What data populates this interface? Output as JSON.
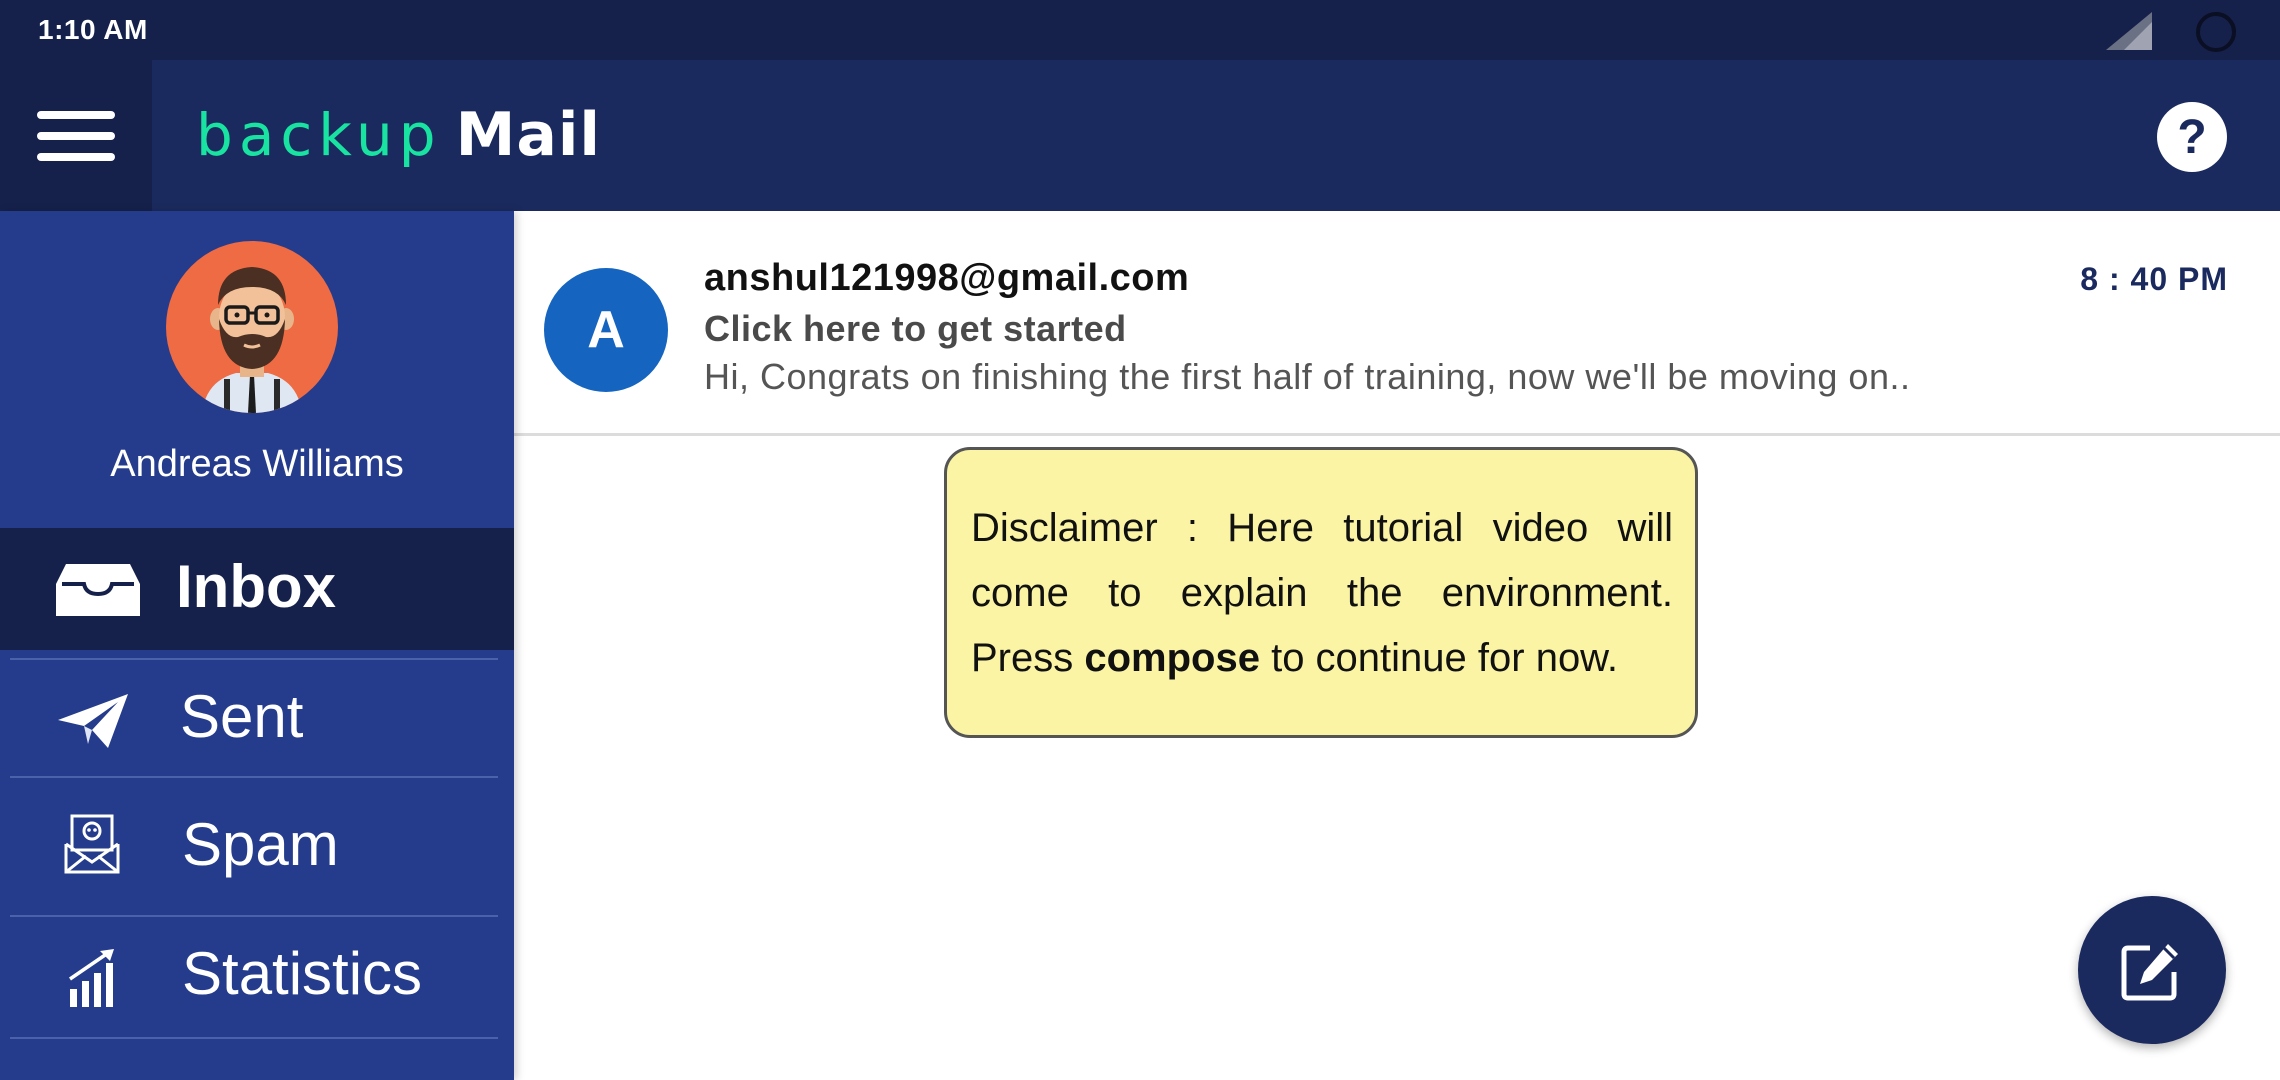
{
  "status_bar": {
    "time": "1:10 AM",
    "icons": [
      "signal-icon",
      "battery-loading-icon"
    ]
  },
  "app_bar": {
    "menu_icon": "hamburger-menu-icon",
    "logo_part1": "backup",
    "logo_part2": "Mail",
    "help_label": "?"
  },
  "sidebar": {
    "user_name": "Andreas Williams",
    "items": [
      {
        "label": "Inbox",
        "icon": "inbox-tray-icon",
        "active": true
      },
      {
        "label": "Sent",
        "icon": "paper-plane-icon",
        "active": false
      },
      {
        "label": "Spam",
        "icon": "spam-envelope-icon",
        "active": false
      },
      {
        "label": "Statistics",
        "icon": "bar-chart-icon",
        "active": false
      }
    ]
  },
  "mail_list": [
    {
      "avatar_letter": "A",
      "sender": "anshul121998@gmail.com",
      "subject": "Click here to get started",
      "preview": "Hi, Congrats on finishing the first half of training, now we'll be moving on..",
      "time": "8 : 40 PM"
    }
  ],
  "disclaimer": {
    "line_before": "Disclaimer : Here tutorial video will come to explain the environment. Press ",
    "emphasis": "compose",
    "line_after": " to continue for now."
  },
  "fab": {
    "icon": "compose-edit-icon"
  },
  "colors": {
    "status_bar": "#16214b",
    "app_bar": "#1b2a5e",
    "sidebar": "#253c8c",
    "logo_accent": "#19e3a0",
    "avatar_bg": "#ee6b44",
    "sender_avatar": "#1565c0",
    "disclaimer_bg": "#faf4a4"
  }
}
